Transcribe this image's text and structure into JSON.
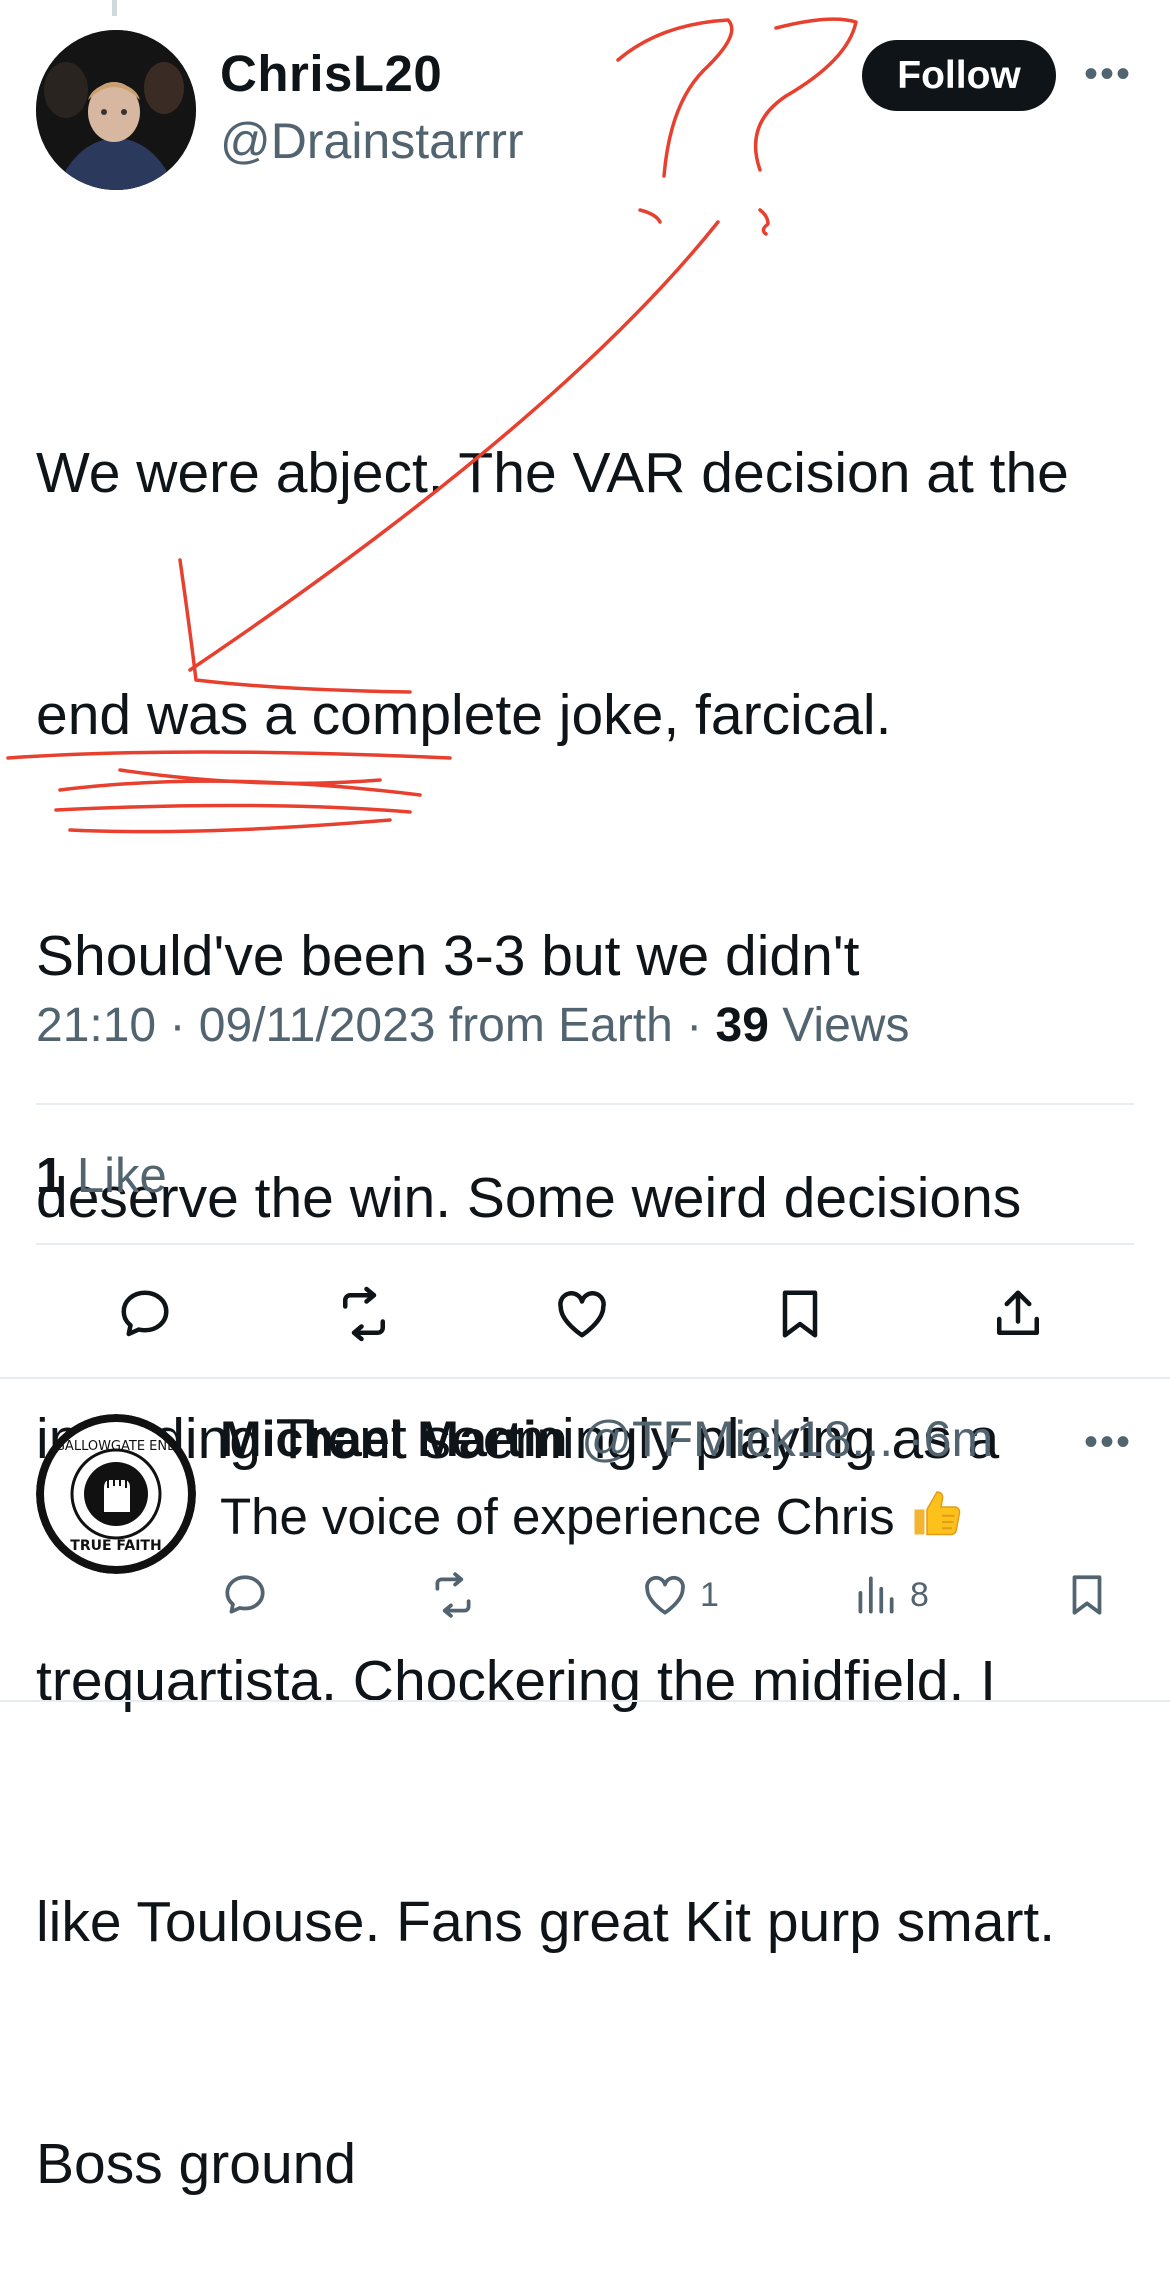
{
  "tweet": {
    "display_name": "ChrisL20",
    "handle": "@Drainstarrrr",
    "follow_label": "Follow",
    "more_label": "•••",
    "text_lines": [
      "We were abject. The VAR decision at the",
      "end was a complete joke, farcical.",
      "Should've been 3-3 but we didn't",
      "deserve the win. Some weird decisions",
      "including Trent seemingly playing as a",
      "trequartista. Chockering the midfield. I",
      "like Toulouse. Fans great Kit purp smart.",
      "Boss ground"
    ],
    "time": "21:10",
    "date": "09/11/2023",
    "source": "from Earth",
    "views_count": "39",
    "views_label": "Views",
    "likes_count": "1",
    "likes_label": "Like"
  },
  "reply": {
    "display_name": "Michael Martin",
    "handle": "@TFMick18...",
    "time": "6m",
    "more_label": "•••",
    "text": "The voice of experience Chris",
    "emoji": "thumbs-up",
    "like_count": "1",
    "views_count": "8",
    "avatar_text_top": "GALLOWGATE END",
    "avatar_text_bottom": "TRUE FAITH"
  },
  "colors": {
    "text": "#0f1419",
    "secondary": "#536471",
    "annotation": "#e8402f",
    "follow_bg": "#0f1419"
  },
  "icons": [
    "reply-icon",
    "retweet-icon",
    "like-icon",
    "bookmark-icon",
    "share-icon",
    "views-icon"
  ]
}
